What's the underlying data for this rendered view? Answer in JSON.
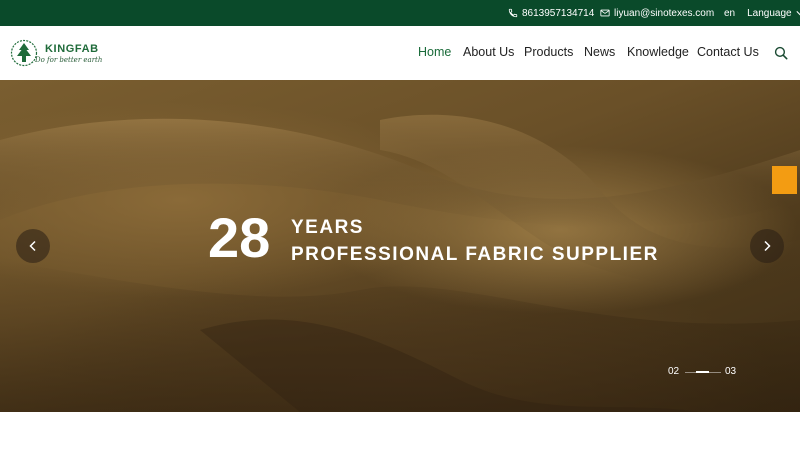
{
  "topbar": {
    "phone": "8613957134714",
    "email": "liyuan@sinotexes.com",
    "lang_code": "en",
    "lang_label": "Language",
    "icons": {
      "phone": "phone-icon",
      "email": "mail-icon",
      "dropdown": "chevron-down-icon"
    }
  },
  "logo": {
    "name": "KINGFAB",
    "slogan": "Do for better earth"
  },
  "nav": {
    "items": [
      {
        "label": "Home",
        "active": true
      },
      {
        "label": "About Us"
      },
      {
        "label": "Products"
      },
      {
        "label": "News"
      },
      {
        "label": "Knowledge"
      },
      {
        "label": "Contact Us"
      }
    ],
    "search_icon": "search-icon"
  },
  "hero": {
    "number": "28",
    "line1": "YEARS",
    "line2": "PROFESSIONAL FABRIC SUPPLIER",
    "pager": {
      "current": "02",
      "total": "03"
    },
    "prev_icon": "chevron-left-icon",
    "next_icon": "chevron-right-icon"
  },
  "colors": {
    "topbar": "#0a4a2a",
    "nav_active": "#1a6b3a",
    "side_tab": "#f39c12",
    "fabric": "#7a5e30"
  }
}
